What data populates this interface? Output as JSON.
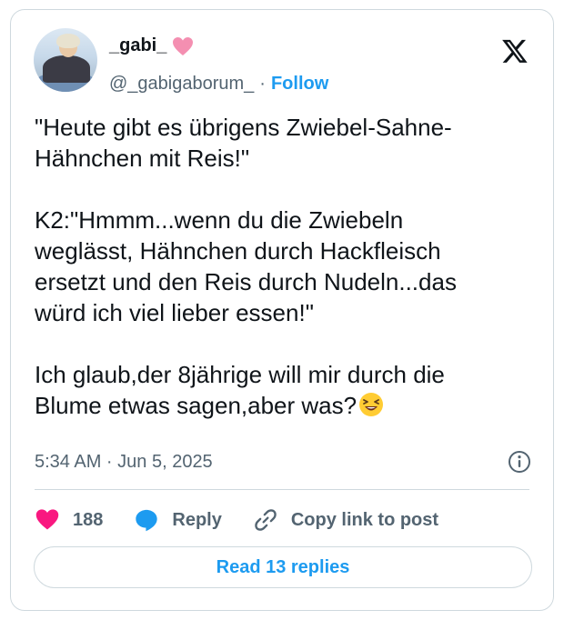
{
  "author": {
    "display_name": "_gabi_",
    "handle": "@_gabigaborum_",
    "separator": "·",
    "follow_label": "Follow"
  },
  "tweet": {
    "text": "\"Heute gibt es übrigens Zwiebel-Sahne-\nHähnchen mit Reis!\"\n\nK2:\"Hmmm...wenn du die Zwiebeln\nweglässt, Hähnchen durch Hackfleisch\nersetzt und den Reis durch Nudeln...das\nwürd ich viel lieber essen!\"\n\nIch glaub,der 8jährige will mir durch die\nBlume etwas sagen,aber was?",
    "timestamp": "5:34 AM · Jun 5, 2025"
  },
  "actions": {
    "likes": "188",
    "reply_label": "Reply",
    "copy_link_label": "Copy link to post"
  },
  "read_replies_label": "Read 13 replies",
  "icons": {
    "name_emoji": "pink-heart-icon",
    "text_emoji": "laughing-face-icon",
    "platform": "x-logo-icon",
    "info": "info-icon",
    "like": "heart-icon",
    "reply": "reply-bubble-icon",
    "copy": "link-icon"
  },
  "colors": {
    "accent": "#1d9bf0",
    "like": "#f91880",
    "muted": "#536471",
    "border": "#cfd9de"
  }
}
